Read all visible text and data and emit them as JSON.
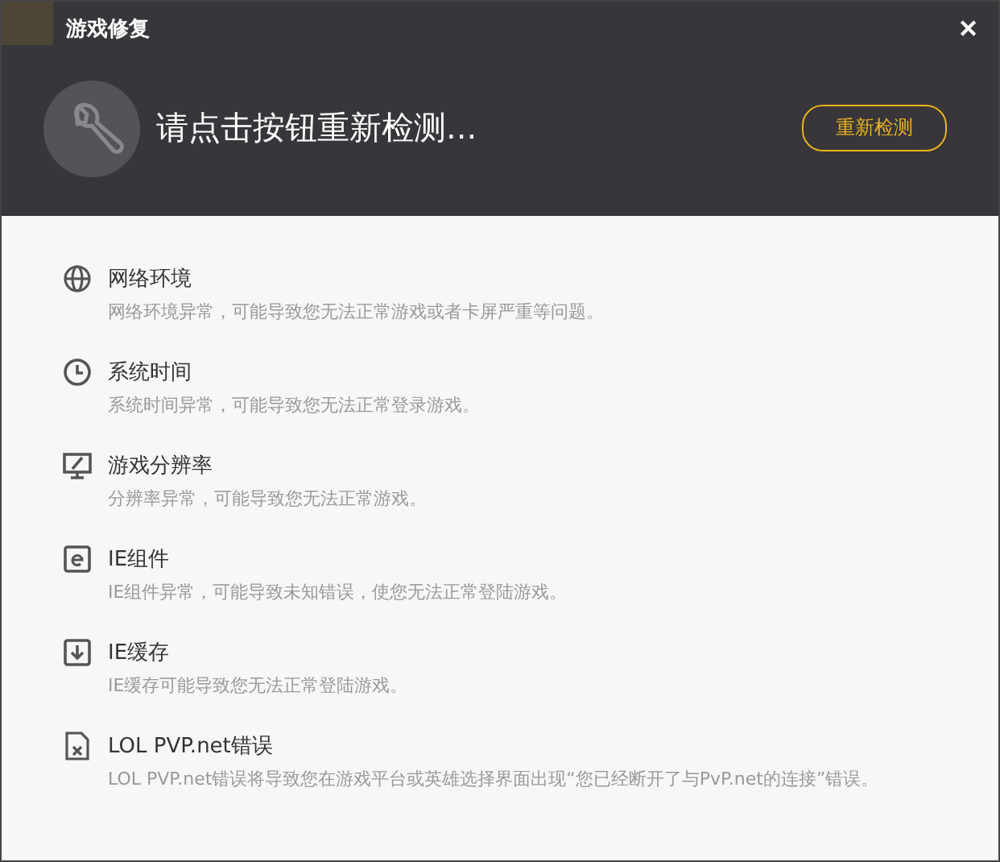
{
  "window": {
    "title": "游戏修复",
    "close": "✕"
  },
  "header": {
    "message": "请点击按钮重新检测...",
    "button": "重新检测"
  },
  "items": [
    {
      "kind": "network",
      "title": "网络环境",
      "description": "网络环境异常，可能导致您无法正常游戏或者卡屏严重等问题。"
    },
    {
      "kind": "clock",
      "title": "系统时间",
      "description": "系统时间异常，可能导致您无法正常登录游戏。"
    },
    {
      "kind": "monitor",
      "title": "游戏分辨率",
      "description": "分辨率异常，可能导致您无法正常游戏。"
    },
    {
      "kind": "ie",
      "title": "IE组件",
      "description": "IE组件异常，可能导致未知错误，使您无法正常登陆游戏。"
    },
    {
      "kind": "cache",
      "title": "IE缓存",
      "description": "IE缓存可能导致您无法正常登陆游戏。"
    },
    {
      "kind": "file-error",
      "title": "LOL PVP.net错误",
      "description": "LOL PVP.net错误将导致您在游戏平台或英雄选择界面出现“您已经断开了与PvP.net的连接”错误。"
    }
  ]
}
